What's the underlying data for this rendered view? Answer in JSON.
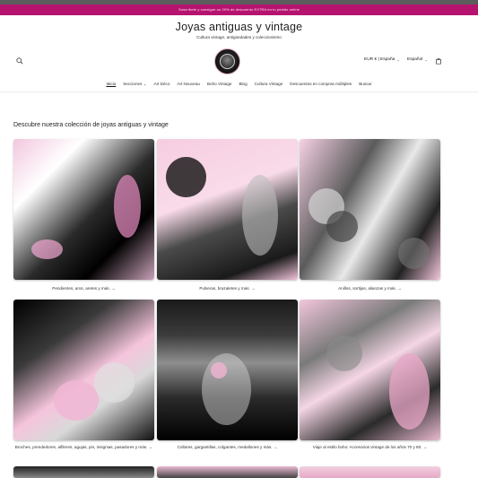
{
  "announcement": {
    "text": "Suscríbete y consigue un 20% de descuento EXTRA en tu pedido online"
  },
  "header": {
    "title": "Joyas antiguas y vintage",
    "subtitle": "Cultura vintage, antigüedades y coleccionismo",
    "currency": "EUR € | España",
    "language": "Español"
  },
  "nav": {
    "items": [
      {
        "label": "Inicio"
      },
      {
        "label": "Secciones"
      },
      {
        "label": "Art Déco"
      },
      {
        "label": "Art Nouveau"
      },
      {
        "label": "Boho Vintage"
      },
      {
        "label": "Blog"
      },
      {
        "label": "Cultura Vintage"
      },
      {
        "label": "Descuentos en compras múltiples"
      },
      {
        "label": "Buscar"
      }
    ]
  },
  "collection": {
    "title": "Descubre nuestra colección de joyas antiguas y vintage",
    "cards": [
      {
        "label": "Pendientes, aros, aretes y más."
      },
      {
        "label": "Pulseras, brazaletes y más."
      },
      {
        "label": "Anillos, sortijas, alianzas y más."
      },
      {
        "label": "Broches, prendedores, alfileres, agujas, pin, insignias, pasadores y más."
      },
      {
        "label": "Collares, gargantillas, colgantes, medallones y más."
      },
      {
        "label": "Viaje al estilo boho: Accesorios vintage de los años 70 y 80."
      }
    ]
  },
  "colors": {
    "announcement_bg": "#b5136f",
    "accent_pink": "#f2c7df"
  },
  "icons": {
    "search": "search-icon",
    "cart": "cart-icon",
    "arrow": "arrow-right-icon",
    "chevron": "chevron-down-icon"
  }
}
